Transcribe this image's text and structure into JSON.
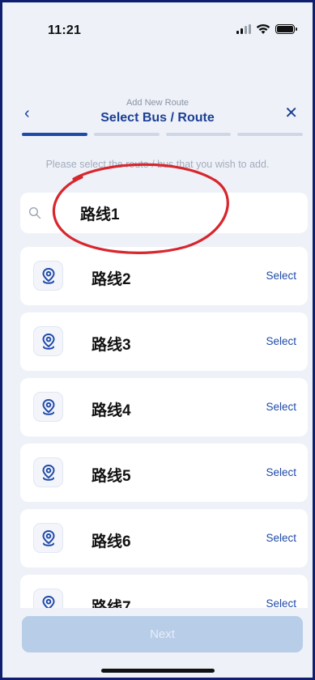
{
  "status_bar": {
    "time": "11:21"
  },
  "header": {
    "subtitle": "Add New Route",
    "title": "Select Bus / Route",
    "back_icon": "chevron-left-icon",
    "close_icon": "close-icon"
  },
  "progress": {
    "steps": 4,
    "current": 1
  },
  "hint": "Please select the route / bus that you wish to add.",
  "search": {
    "value": "路线1",
    "icon": "search-icon"
  },
  "routes": [
    {
      "name": "路线2",
      "action": "Select"
    },
    {
      "name": "路线3",
      "action": "Select"
    },
    {
      "name": "路线4",
      "action": "Select"
    },
    {
      "name": "路线5",
      "action": "Select"
    },
    {
      "name": "路线6",
      "action": "Select"
    },
    {
      "name": "路线7",
      "action": "Select"
    }
  ],
  "footer": {
    "next_label": "Next"
  },
  "colors": {
    "accent": "#1f4aa8",
    "title": "#1c3f94",
    "annotation": "#d8262d",
    "background": "#eef2f8"
  }
}
